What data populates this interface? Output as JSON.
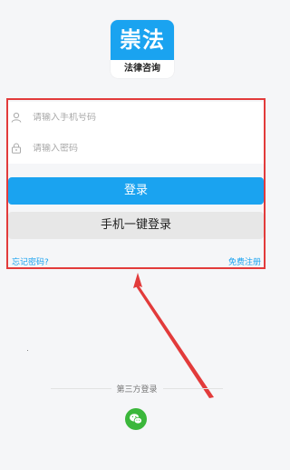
{
  "logo": {
    "title": "崇法",
    "subtitle": "法律咨询"
  },
  "login_form": {
    "phone_placeholder": "请输入手机号码",
    "password_placeholder": "请输入密码",
    "login_label": "登录",
    "one_click_label": "手机一键登录",
    "forgot_label": "忘记密码?",
    "register_label": "免费注册"
  },
  "third_party": {
    "label": "第三方登录",
    "provider_icon": "wechat-icon"
  },
  "colors": {
    "accent": "#1aa3f0",
    "annotation": "#e23b3b",
    "wechat": "#3bb73b"
  }
}
